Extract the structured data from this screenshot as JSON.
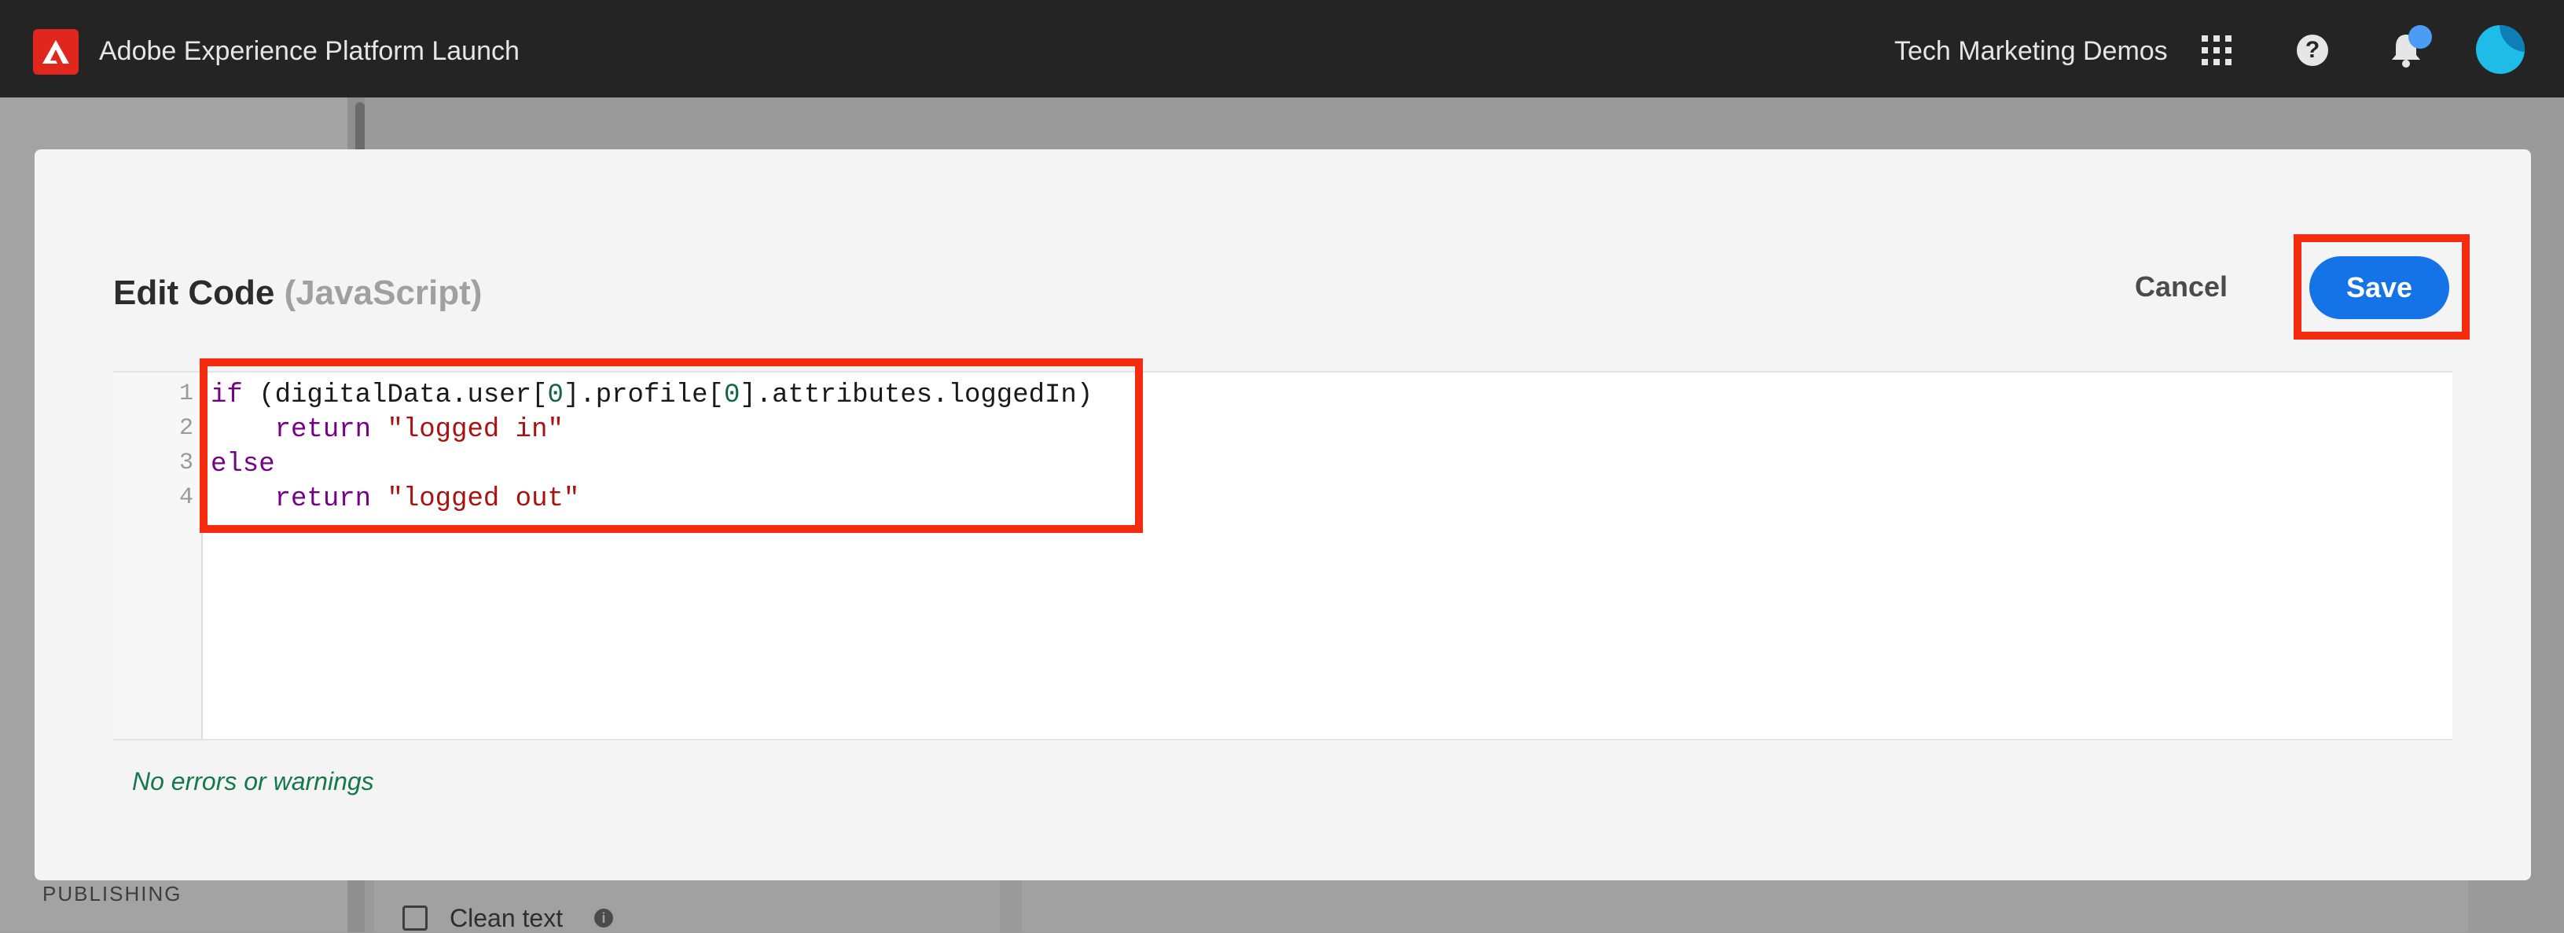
{
  "app": {
    "title": "Adobe Experience Platform Launch",
    "org_name": "Tech Marketing Demos",
    "icons": [
      "adobe-logo",
      "apps-grid-icon",
      "help-icon",
      "bell-icon",
      "avatar"
    ],
    "accent_color": "#1473e6",
    "logo_color": "#e0261d"
  },
  "background": {
    "publishing_label": "PUBLISHING",
    "clean_text_label": "Clean text"
  },
  "modal": {
    "title": "Edit Code",
    "language": "(JavaScript)",
    "cancel_label": "Cancel",
    "save_label": "Save",
    "status": "No errors or warnings",
    "status_color": "#15784a"
  },
  "editor": {
    "lines": [
      {
        "no": "1",
        "text": "if (digitalData.user[0].profile[0].attributes.loggedIn)"
      },
      {
        "no": "2",
        "text": "    return \"logged in\""
      },
      {
        "no": "3",
        "text": "else"
      },
      {
        "no": "4",
        "text": "    return \"logged out\""
      }
    ]
  }
}
